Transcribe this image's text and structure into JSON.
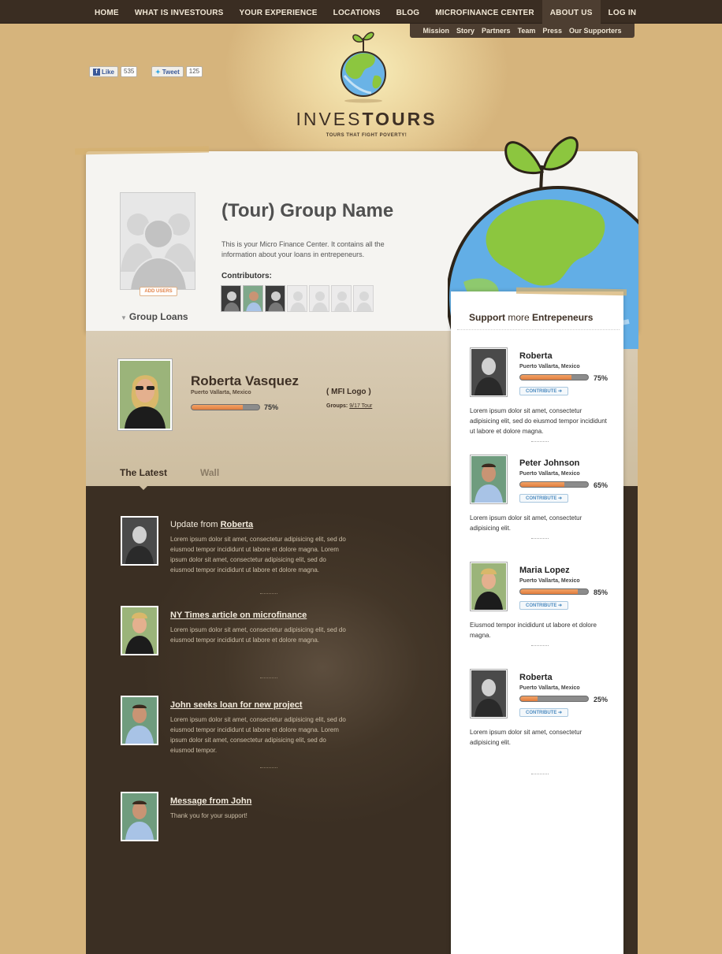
{
  "nav": {
    "items": [
      "HOME",
      "WHAT IS INVESTOURS",
      "YOUR EXPERIENCE",
      "LOCATIONS",
      "BLOG",
      "MICROFINANCE CENTER",
      "ABOUT US",
      "LOG IN"
    ],
    "sub_items": [
      "Mission",
      "Story",
      "Partners",
      "Team",
      "Press",
      "Our Supporters"
    ]
  },
  "social": {
    "like_label": "Like",
    "like_count": "535",
    "tweet_label": "Tweet",
    "tweet_count": "125"
  },
  "logo": {
    "title_light": "INVES",
    "title_bold": "TOURS",
    "tagline": "TOURS THAT FIGHT POVERTY!"
  },
  "group": {
    "add_users": "ADD USERS",
    "group_loans": "Group Loans",
    "name": "(Tour) Group Name",
    "description": "This is your Micro Finance Center. It contains all the information about your loans in entrepeneurs.",
    "contributors_label": "Contributors:"
  },
  "profile": {
    "name": "Roberta Vasquez",
    "location": "Puerto Vallarta, Mexico",
    "progress": 0.75,
    "percent": "75%",
    "mfi": "( MFI Logo )",
    "groups_label": "Groups:",
    "groups_link": "9/17 Tour"
  },
  "tabs": [
    "The Latest",
    "Wall"
  ],
  "feed": [
    {
      "prefix": "Update from ",
      "title": "Roberta",
      "body": "Lorem ipsum dolor sit amet, consectetur adipisicing elit, sed do eiusmod tempor incididunt ut labore et dolore magna. Lorem ipsum dolor sit amet, consectetur adipisicing elit, sed do eiusmod tempor incididunt ut labore et dolore magna."
    },
    {
      "prefix": "",
      "title": "NY Times article on microfinance",
      "body": "Lorem ipsum dolor sit amet, consectetur adipisicing elit, sed do eiusmod tempor incididunt ut labore et dolore magna."
    },
    {
      "prefix": "",
      "title": "John seeks loan for new project",
      "body": "Lorem ipsum dolor sit amet, consectetur adipisicing elit, sed do eiusmod tempor incididunt ut labore et dolore magna. Lorem ipsum dolor sit amet, consectetur adipisicing elit, sed do eiusmod tempor."
    },
    {
      "prefix": "",
      "title": "Message from John",
      "body": "Thank you for your support!"
    }
  ],
  "sidebar": {
    "title_a": "Support ",
    "title_b": "more ",
    "title_c": "Entrepeneurs",
    "contribute_label": "CONTRIBUTE  ➜",
    "entries": [
      {
        "name": "Roberta",
        "location": "Puerto Vallarta, Mexico",
        "progress": 0.75,
        "percent": "75%",
        "body": "Lorem ipsum dolor sit amet, consectetur adipisicing elit, sed do eiusmod tempor incididunt ut labore et dolore magna."
      },
      {
        "name": "Peter Johnson",
        "location": "Puerto Vallarta, Mexico",
        "progress": 0.65,
        "percent": "65%",
        "body": "Lorem ipsum dolor sit amet, consectetur adipisicing elit."
      },
      {
        "name": "Maria Lopez",
        "location": "Puerto Vallarta, Mexico",
        "progress": 0.85,
        "percent": "85%",
        "body": "Eiusmod tempor incididunt ut labore et dolore magna."
      },
      {
        "name": "Roberta",
        "location": "Puerto Vallarta, Mexico",
        "progress": 0.25,
        "percent": "25%",
        "body": "Lorem ipsum dolor sit amet, consectetur adipisicing elit."
      }
    ]
  },
  "colors": {
    "accent_orange": "#e07d3e",
    "dark_brown": "#3b2f23",
    "paper": "#f5f4f1",
    "tan": "#d6b47c",
    "contribute_blue": "#4f8dc1"
  }
}
